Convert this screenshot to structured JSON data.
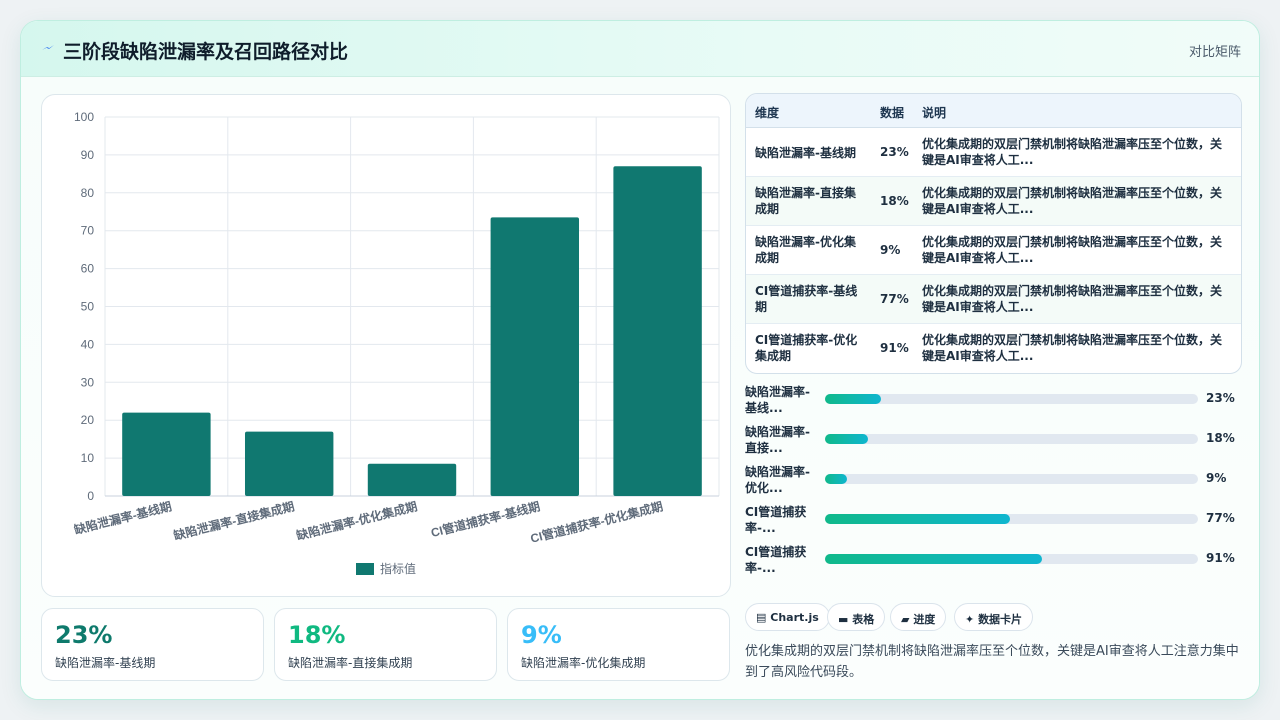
{
  "header": {
    "title": "三阶段缺陷泄漏率及召回路径对比",
    "tag": "对比矩阵"
  },
  "chart_data": {
    "type": "bar",
    "categories": [
      "缺陷泄漏率-基线期",
      "缺陷泄漏率-直接集成期",
      "缺陷泄漏率-优化集成期",
      "CI管道捕获率-基线期",
      "CI管道捕获率-优化集成期"
    ],
    "series": [
      {
        "name": "指标值",
        "values": [
          22,
          17,
          8.5,
          73.5,
          87
        ]
      }
    ],
    "ylim": [
      0,
      100
    ],
    "yticks": [
      0,
      10,
      20,
      30,
      40,
      50,
      60,
      70,
      80,
      90,
      100
    ],
    "grid": true,
    "legend": "bottom",
    "bar_color": "#107870"
  },
  "stats": [
    {
      "value": "23%",
      "label": "缺陷泄漏率-基线期",
      "color": "#0e7a6c"
    },
    {
      "value": "18%",
      "label": "缺陷泄漏率-直接集成期",
      "color": "#10b981"
    },
    {
      "value": "9%",
      "label": "缺陷泄漏率-优化集成期",
      "color": "#38bdf8"
    }
  ],
  "table": {
    "headers": [
      "维度",
      "数据",
      "说明"
    ],
    "rows": [
      {
        "dim": "缺陷泄漏率-基线期",
        "num": "23%",
        "desc": "优化集成期的双层门禁机制将缺陷泄漏率压至个位数，关键是AI审查将人工..."
      },
      {
        "dim": "缺陷泄漏率-直接集成期",
        "num": "18%",
        "desc": "优化集成期的双层门禁机制将缺陷泄漏率压至个位数，关键是AI审查将人工..."
      },
      {
        "dim": "缺陷泄漏率-优化集成期",
        "num": "9%",
        "desc": "优化集成期的双层门禁机制将缺陷泄漏率压至个位数，关键是AI审查将人工..."
      },
      {
        "dim": "CI管道捕获率-基线期",
        "num": "77%",
        "desc": "优化集成期的双层门禁机制将缺陷泄漏率压至个位数，关键是AI审查将人工..."
      },
      {
        "dim": "CI管道捕获率-优化集成期",
        "num": "91%",
        "desc": "优化集成期的双层门禁机制将缺陷泄漏率压至个位数，关键是AI审查将人工..."
      }
    ]
  },
  "progress": [
    {
      "label": "缺陷泄漏率-基线...",
      "fraction": 0.15,
      "value": "23%"
    },
    {
      "label": "缺陷泄漏率-直接...",
      "fraction": 0.115,
      "value": "18%"
    },
    {
      "label": "缺陷泄漏率-优化...",
      "fraction": 0.06,
      "value": "9%"
    },
    {
      "label": "CI管道捕获率-...",
      "fraction": 0.495,
      "value": "77%"
    },
    {
      "label": "CI管道捕获率-...",
      "fraction": 0.582,
      "value": "91%"
    }
  ],
  "chips": [
    {
      "icon": "chart-icon",
      "glyph": "▤",
      "label": "Chart.js"
    },
    {
      "icon": "table-icon",
      "glyph": "▬",
      "label": "表格"
    },
    {
      "icon": "progress-icon",
      "glyph": "▰",
      "label": "进度"
    },
    {
      "icon": "card-icon",
      "glyph": "✦",
      "label": "数据卡片"
    }
  ],
  "note": "优化集成期的双层门禁机制将缺陷泄漏率压至个位数，关键是AI审查将人工注意力集中到了高风险代码段。"
}
